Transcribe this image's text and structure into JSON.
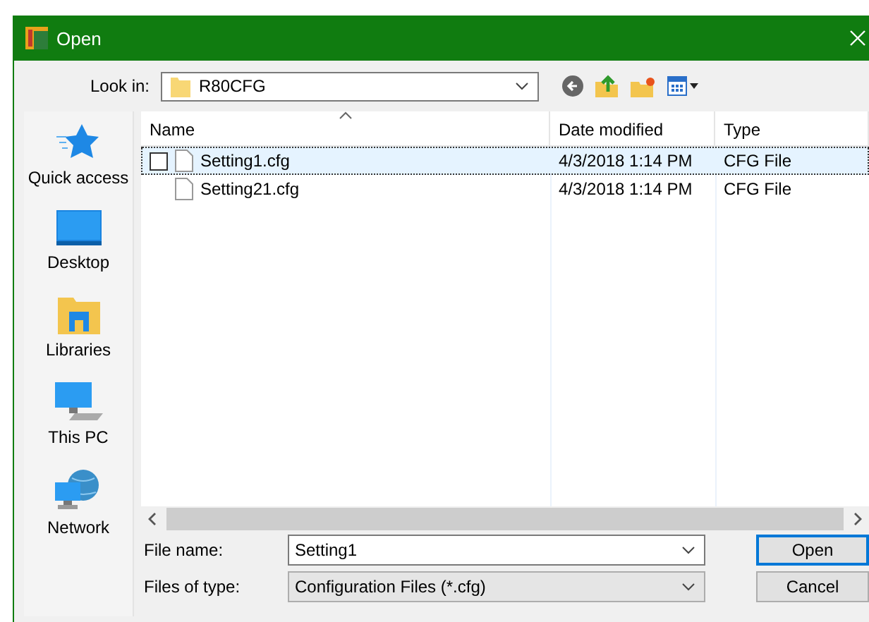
{
  "window": {
    "title": "Open"
  },
  "look_in": {
    "label": "Look in:",
    "value": "R80CFG"
  },
  "places": [
    {
      "kind": "star",
      "label": "Quick access"
    },
    {
      "kind": "desktop",
      "label": "Desktop"
    },
    {
      "kind": "libraries",
      "label": "Libraries"
    },
    {
      "kind": "pc",
      "label": "This PC"
    },
    {
      "kind": "network",
      "label": "Network"
    }
  ],
  "table": {
    "columns": [
      "Name",
      "Date modified",
      "Type"
    ],
    "rows": [
      {
        "name": "Setting1.cfg",
        "date": "4/3/2018 1:14 PM",
        "type": "CFG File",
        "selected": true
      },
      {
        "name": "Setting21.cfg",
        "date": "4/3/2018 1:14 PM",
        "type": "CFG File",
        "selected": false
      }
    ]
  },
  "file_name": {
    "label": "File name:",
    "value": "Setting1"
  },
  "file_type": {
    "label": "Files of type:",
    "value": "Configuration Files (*.cfg)"
  },
  "buttons": [
    "Open",
    "Cancel"
  ]
}
